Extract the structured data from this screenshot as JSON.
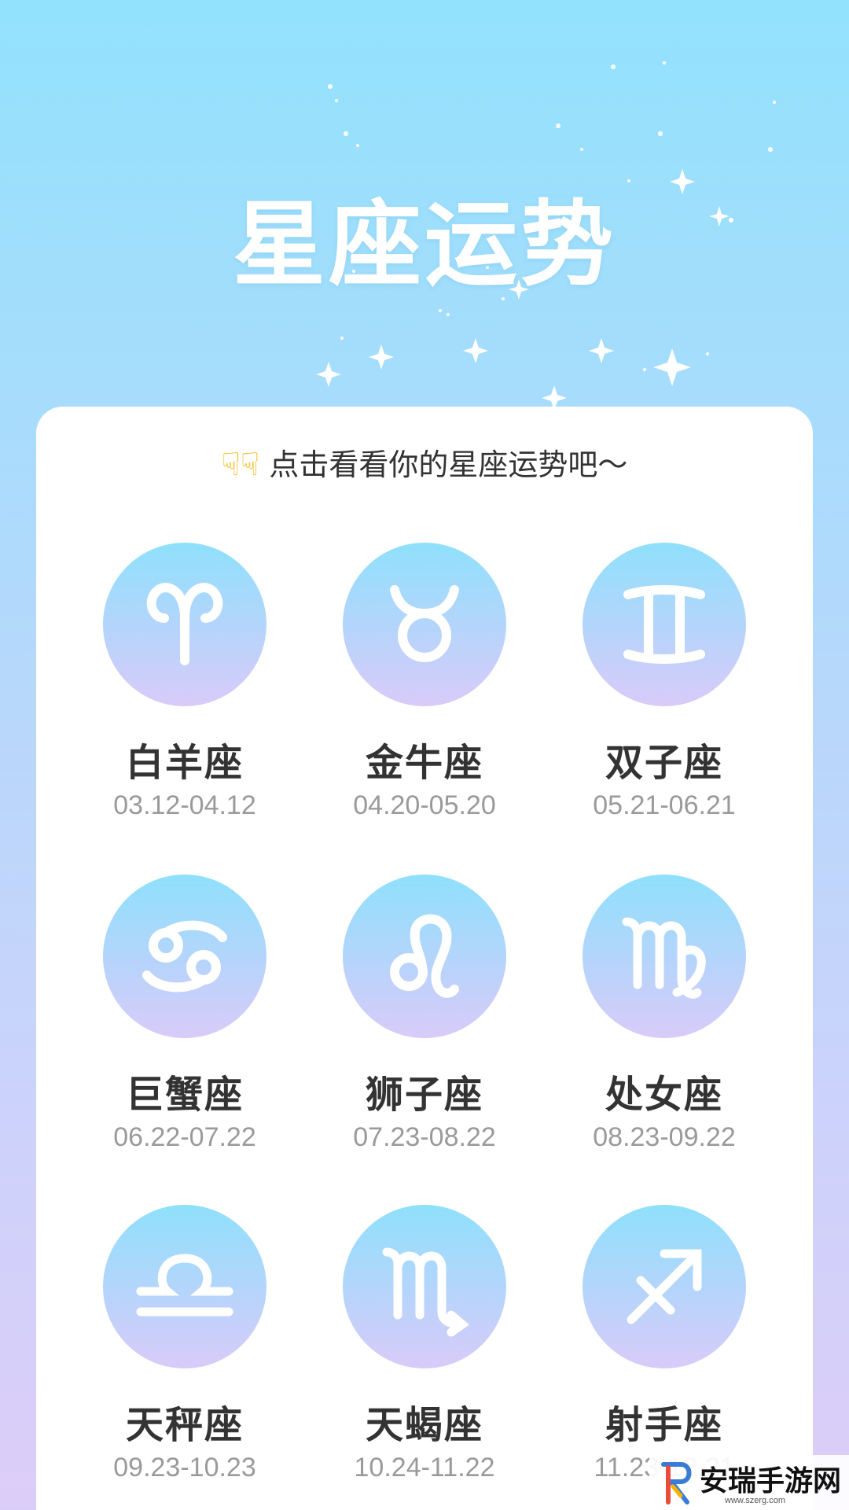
{
  "header": {
    "title": "星座运势"
  },
  "prompt": {
    "hand_icon": "pointing-down-hand-icon",
    "text": "点击看看你的星座运势吧～"
  },
  "signs": [
    {
      "name": "白羊座",
      "date": "03.12-04.12",
      "icon": "aries-icon"
    },
    {
      "name": "金牛座",
      "date": "04.20-05.20",
      "icon": "taurus-icon"
    },
    {
      "name": "双子座",
      "date": "05.21-06.21",
      "icon": "gemini-icon"
    },
    {
      "name": "巨蟹座",
      "date": "06.22-07.22",
      "icon": "cancer-icon"
    },
    {
      "name": "狮子座",
      "date": "07.23-08.22",
      "icon": "leo-icon"
    },
    {
      "name": "处女座",
      "date": "08.23-09.22",
      "icon": "virgo-icon"
    },
    {
      "name": "天秤座",
      "date": "09.23-10.23",
      "icon": "libra-icon"
    },
    {
      "name": "天蝎座",
      "date": "10.24-11.22",
      "icon": "scorpio-icon"
    },
    {
      "name": "射手座",
      "date": "11.23-12.21",
      "icon": "sagittarius-icon"
    }
  ],
  "watermark": {
    "text": "安瑞手游网",
    "url": "www.szerg.com"
  },
  "colors": {
    "bg_top": "#92e2fd",
    "bg_bottom": "#dccdf8",
    "circle_top": "#8fe0fc",
    "circle_bottom": "#d9cbf9",
    "name": "#333333",
    "date": "#9a9a9a"
  }
}
